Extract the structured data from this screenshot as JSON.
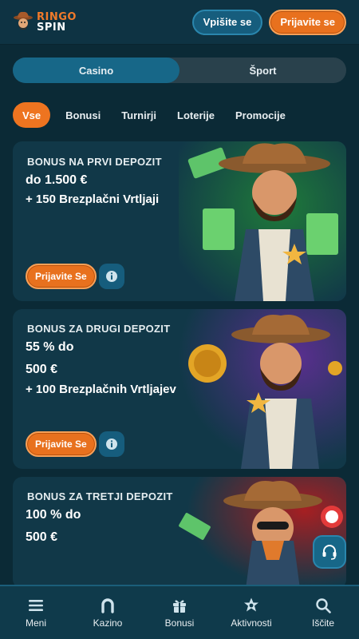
{
  "header": {
    "logo_line1": "RINGO",
    "logo_line2": "SPIN",
    "login_label": "Vpišite se",
    "register_label": "Prijavite se"
  },
  "segment": {
    "tabs": [
      {
        "label": "Casino",
        "active": true
      },
      {
        "label": "Šport",
        "active": false
      }
    ]
  },
  "filters": [
    {
      "label": "Vse",
      "active": true
    },
    {
      "label": "Bonusi",
      "active": false
    },
    {
      "label": "Turnirji",
      "active": false
    },
    {
      "label": "Loterije",
      "active": false
    },
    {
      "label": "Promocije",
      "active": false
    }
  ],
  "promos": [
    {
      "kicker": "BONUS NA PRVI DEPOZIT",
      "lines": [
        "do 1.500 €",
        "+ 150 Brezplačni Vrtljaji"
      ],
      "cta_label": "Prijavite Se",
      "theme": "green"
    },
    {
      "kicker": "BONUS ZA DRUGI DEPOZIT",
      "lines": [
        "55 % do",
        "500 €",
        "+ 100 Brezplačnih Vrtljajev"
      ],
      "cta_label": "Prijavite Se",
      "theme": "purple"
    },
    {
      "kicker": "BONUS ZA TRETJI DEPOZIT",
      "lines": [
        "100 % do",
        "500 €"
      ],
      "cta_label": "",
      "theme": "red"
    }
  ],
  "bottom_nav": [
    {
      "label": "Meni",
      "icon": "menu-icon"
    },
    {
      "label": "Kazino",
      "icon": "horseshoe-icon"
    },
    {
      "label": "Bonusi",
      "icon": "gift-icon"
    },
    {
      "label": "Aktivnosti",
      "icon": "sheriff-star-icon"
    },
    {
      "label": "Iščite",
      "icon": "search-icon"
    }
  ],
  "colors": {
    "background": "#0b2a36",
    "accent_orange": "#e8711e",
    "accent_blue": "#176788"
  }
}
